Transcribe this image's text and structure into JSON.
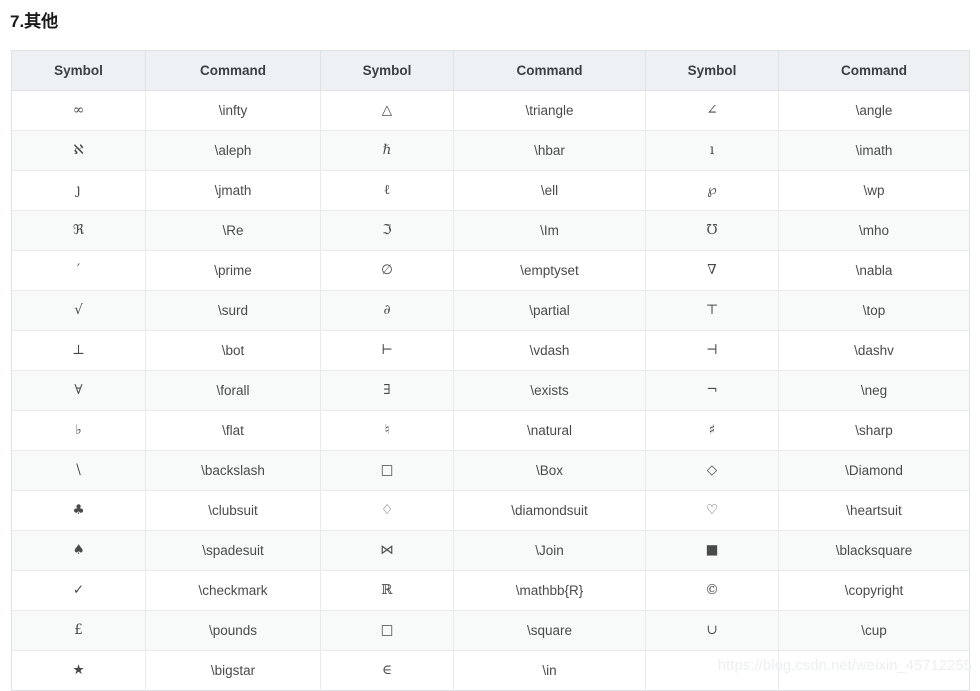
{
  "page": {
    "title": "7.其他",
    "watermark": "https://blog.csdn.net/weixin_45712255"
  },
  "table": {
    "headers": [
      "Symbol",
      "Command",
      "Symbol",
      "Command",
      "Symbol",
      "Command"
    ],
    "rows": [
      [
        "∞",
        "\\infty",
        "△",
        "\\triangle",
        "∠",
        "\\angle"
      ],
      [
        "ℵ",
        "\\aleph",
        "ℏ",
        "\\hbar",
        "ı",
        "\\imath"
      ],
      [
        "ȷ",
        "\\jmath",
        "ℓ",
        "\\ell",
        "℘",
        "\\wp"
      ],
      [
        "ℜ",
        "\\Re",
        "ℑ",
        "\\Im",
        "℧",
        "\\mho"
      ],
      [
        "′",
        "\\prime",
        "∅",
        "\\emptyset",
        "∇",
        "\\nabla"
      ],
      [
        "√",
        "\\surd",
        "∂",
        "\\partial",
        "⊤",
        "\\top"
      ],
      [
        "⊥",
        "\\bot",
        "⊢",
        "\\vdash",
        "⊣",
        "\\dashv"
      ],
      [
        "∀",
        "\\forall",
        "∃",
        "\\exists",
        "¬",
        "\\neg"
      ],
      [
        "♭",
        "\\flat",
        "♮",
        "\\natural",
        "♯",
        "\\sharp"
      ],
      [
        "\\",
        "\\backslash",
        "□",
        "\\Box",
        "◇",
        "\\Diamond"
      ],
      [
        "♣",
        "\\clubsuit",
        "♢",
        "\\diamondsuit",
        "♡",
        "\\heartsuit"
      ],
      [
        "♠",
        "\\spadesuit",
        "⋈",
        "\\Join",
        "■",
        "\\blacksquare"
      ],
      [
        "✓",
        "\\checkmark",
        "ℝ",
        "\\mathbb{R}",
        "©",
        "\\copyright"
      ],
      [
        "£",
        "\\pounds",
        "□",
        "\\square",
        "∪",
        "\\cup"
      ],
      [
        "★",
        "\\bigstar",
        "∈",
        "\\in",
        "",
        ""
      ]
    ]
  },
  "colors": {
    "header_bg": "#eef1f4",
    "row_alt_bg": "#f8f9f9",
    "border": "#dfe2e5",
    "text": "#4a4a4a",
    "title": "#1a1a1a",
    "watermark": "#eceef0"
  }
}
